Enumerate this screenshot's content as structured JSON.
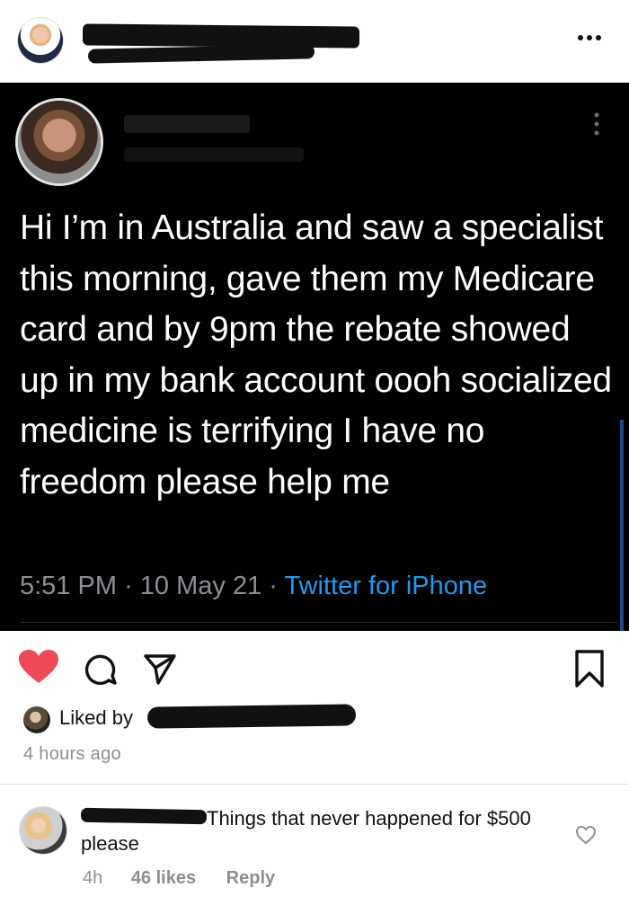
{
  "post": {
    "tweet": {
      "text": "Hi I’m in Australia and saw a specialist this morning, gave them my Medicare card and by 9pm the rebate showed up in my bank account oooh socialized medicine is terrifying I have no freedom please help me",
      "time": "5:51 PM",
      "date": "10 May 21",
      "separator": "·",
      "source": "Twitter for iPhone"
    },
    "actions": {
      "liked": true,
      "icons": [
        "heart-icon",
        "comment-icon",
        "share-icon",
        "bookmark-icon"
      ]
    },
    "likes": {
      "prefix": "Liked by"
    },
    "time_ago": "4 hours ago",
    "comment": {
      "text": "Things that never happened for $500 please",
      "time": "4h",
      "likes": "46 likes",
      "reply": "Reply"
    }
  },
  "colors": {
    "heart": "#ed4956",
    "twitter_blue": "#1d9bf0",
    "meta_gray": "#8e8e8e"
  }
}
